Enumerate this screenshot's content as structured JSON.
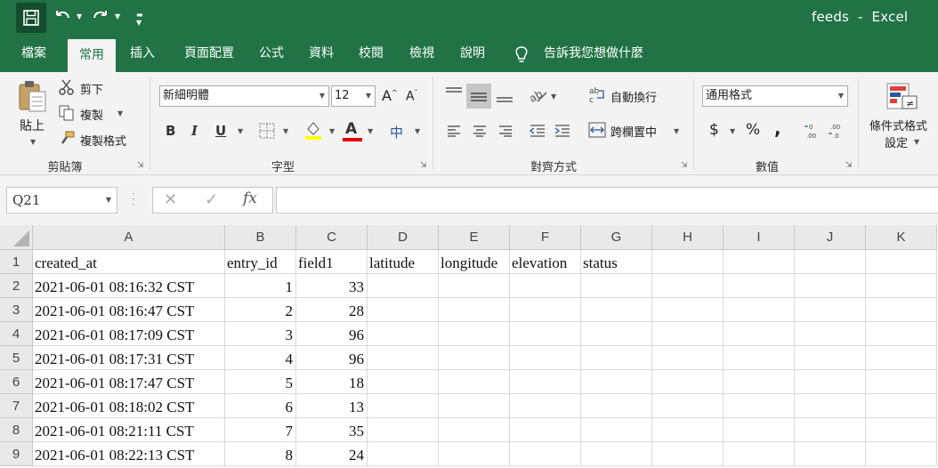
{
  "window": {
    "title": "feeds  -  Excel"
  },
  "quick_access": {
    "save_icon": "save-icon",
    "undo_icon": "undo-icon",
    "redo_icon": "redo-icon",
    "customize_icon": "customize-icon"
  },
  "tabs": [
    {
      "label": "檔案",
      "active": false
    },
    {
      "label": "常用",
      "active": true
    },
    {
      "label": "插入",
      "active": false
    },
    {
      "label": "頁面配置",
      "active": false
    },
    {
      "label": "公式",
      "active": false
    },
    {
      "label": "資料",
      "active": false
    },
    {
      "label": "校閱",
      "active": false
    },
    {
      "label": "檢視",
      "active": false
    },
    {
      "label": "說明",
      "active": false
    }
  ],
  "tell_me": "告訴我您想做什麼",
  "ribbon": {
    "clipboard": {
      "label": "剪貼簿",
      "paste": "貼上",
      "cut": "剪下",
      "copy": "複製",
      "format_painter": "複製格式"
    },
    "font": {
      "label": "字型",
      "font_name": "新細明體",
      "font_size": "12",
      "bold": "B",
      "italic": "I",
      "underline": "U",
      "font_color": "A",
      "phonetic": "中"
    },
    "alignment": {
      "label": "對齊方式",
      "wrap_text": "自動換行",
      "merge_center": "跨欄置中"
    },
    "number": {
      "label": "數值",
      "format": "通用格式",
      "currency": "$",
      "percent": "%",
      "comma": ","
    },
    "styles": {
      "conditional_line1": "條件式格式",
      "conditional_line2": "設定"
    }
  },
  "formula_bar": {
    "name_box": "Q21",
    "fx": "fx",
    "value": ""
  },
  "sheet": {
    "columns": [
      "A",
      "B",
      "C",
      "D",
      "E",
      "F",
      "G",
      "H",
      "I",
      "J",
      "K"
    ],
    "row_numbers": [
      "1",
      "2",
      "3",
      "4",
      "5",
      "6",
      "7",
      "8",
      "9"
    ],
    "rows": [
      [
        "created_at",
        "entry_id",
        "field1",
        "latitude",
        "longitude",
        "elevation",
        "status",
        "",
        "",
        "",
        ""
      ],
      [
        "2021-06-01 08:16:32 CST",
        "1",
        "33",
        "",
        "",
        "",
        "",
        "",
        "",
        "",
        ""
      ],
      [
        "2021-06-01 08:16:47 CST",
        "2",
        "28",
        "",
        "",
        "",
        "",
        "",
        "",
        "",
        ""
      ],
      [
        "2021-06-01 08:17:09 CST",
        "3",
        "96",
        "",
        "",
        "",
        "",
        "",
        "",
        "",
        ""
      ],
      [
        "2021-06-01 08:17:31 CST",
        "4",
        "96",
        "",
        "",
        "",
        "",
        "",
        "",
        "",
        ""
      ],
      [
        "2021-06-01 08:17:47 CST",
        "5",
        "18",
        "",
        "",
        "",
        "",
        "",
        "",
        "",
        ""
      ],
      [
        "2021-06-01 08:18:02 CST",
        "6",
        "13",
        "",
        "",
        "",
        "",
        "",
        "",
        "",
        ""
      ],
      [
        "2021-06-01 08:21:11 CST",
        "7",
        "35",
        "",
        "",
        "",
        "",
        "",
        "",
        "",
        ""
      ],
      [
        "2021-06-01 08:22:13 CST",
        "8",
        "24",
        "",
        "",
        "",
        "",
        "",
        "",
        "",
        ""
      ]
    ]
  },
  "colors": {
    "brand": "#217346",
    "ribbon_bg": "#f3f3f3",
    "header_bg": "#e9e9e9"
  }
}
